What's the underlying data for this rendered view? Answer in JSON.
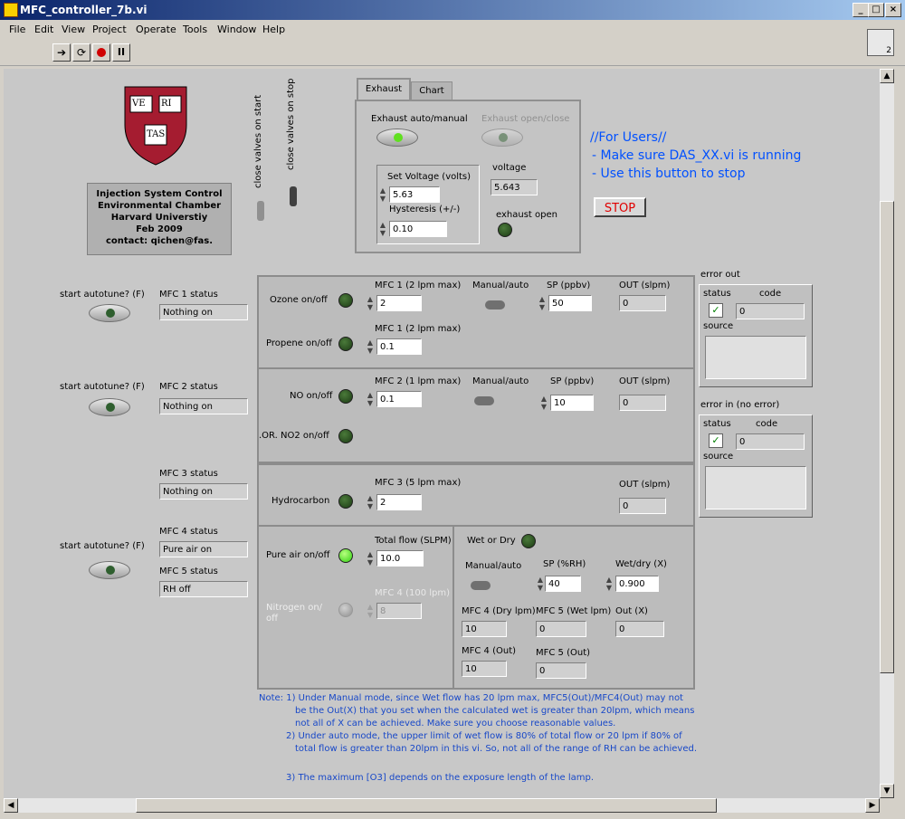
{
  "window": {
    "title": "MFC_controller_7b.vi",
    "min": "_",
    "max": "□",
    "close": "×"
  },
  "menu": [
    "File",
    "Edit",
    "View",
    "Project",
    "Operate",
    "Tools",
    "Window",
    "Help"
  ],
  "toolbar": {
    "icons": [
      "run-arrow-icon",
      "run-continuous-icon",
      "abort-icon",
      "pause-icon"
    ]
  },
  "context": {
    "num": "2"
  },
  "logo": {
    "v1": "VE",
    "v2": "RI",
    "v3": "TAS"
  },
  "info": {
    "lines": [
      "Injection System Control",
      "Environmental Chamber",
      "Harvard Universtiy",
      "Feb 2009",
      "contact: qichen@fas."
    ]
  },
  "valves": {
    "start": "close valves on start",
    "stop": "close valves on stop"
  },
  "tabs": {
    "exhaust": "Exhaust",
    "chart": "Chart"
  },
  "exhaust": {
    "auto_label": "Exhaust auto/manual",
    "open_label": "Exhaust open/close",
    "set_voltage_label": "Set Voltage (volts)",
    "set_voltage": "5.63",
    "voltage_label": "voltage",
    "voltage": "5.643",
    "hyst_label": "Hysteresis (+/-)",
    "hyst": "0.10",
    "open_led_label": "exhaust open"
  },
  "users": {
    "l1": "//For Users//",
    "l2": "- Make sure DAS_XX.vi is running",
    "l3": "- Use this button to stop",
    "stop": "STOP"
  },
  "autotune": {
    "label": "start autotune? (F)"
  },
  "mfc1": {
    "status_label": "MFC 1 status",
    "status": "Nothing on",
    "ozone": "Ozone on/off",
    "mfc_label": "MFC 1 (2 lpm max)",
    "val": "2",
    "propene": "Propene on/off",
    "mfc_label2": "MFC 1 (2 lpm max)",
    "val2": "0.1",
    "mode": "Manual/auto",
    "sp_label": "SP (ppbv)",
    "sp": "50",
    "out_label": "OUT (slpm)",
    "out": "0"
  },
  "mfc2": {
    "status_label": "MFC 2 status",
    "status": "Nothing on",
    "no": "NO on/off",
    "mfc_label": "MFC 2 (1 lpm max)",
    "val": "0.1",
    "no2": ".OR. NO2 on/off",
    "mode": "Manual/auto",
    "sp_label": "SP (ppbv)",
    "sp": "10",
    "out_label": "OUT (slpm)",
    "out": "0"
  },
  "mfc3": {
    "status_label": "MFC 3 status",
    "status": "Nothing on",
    "hc": "Hydrocarbon",
    "mfc_label": "MFC 3 (5 lpm max)",
    "val": "2",
    "out_label": "OUT (slpm)",
    "out": "0"
  },
  "mfc4": {
    "status_label": "MFC 4 status",
    "status": "Pure air on",
    "pure": "Pure air on/off",
    "total_label": "Total flow (SLPM)",
    "total": "10.0",
    "n2": "Nitrogen on/",
    "n2b": "off",
    "mfc4_label": "MFC 4 (100 lpm)",
    "mfc4_val": "8"
  },
  "mfc5": {
    "status_label": "MFC 5 status",
    "status": "RH off"
  },
  "wet": {
    "label": "Wet or Dry",
    "mode": "Manual/auto",
    "sp_label": "SP (%RH)",
    "sp": "40",
    "wd_label": "Wet/dry (X)",
    "wd": "0.900",
    "dry_label": "MFC 4 (Dry lpm)",
    "dry": "10",
    "wetl_label": "MFC 5 (Wet lpm)",
    "wetl": "0",
    "outx_label": "Out (X)",
    "outx": "0",
    "out4_label": "MFC 4 (Out)",
    "out4": "10",
    "out5_label": "MFC 5 (Out)",
    "out5": "0"
  },
  "errout": {
    "title": "error out",
    "status": "status",
    "code": "code",
    "codeval": "0",
    "source": "source",
    "check": "✓"
  },
  "errin": {
    "title": "error in (no error)",
    "status": "status",
    "code": "code",
    "codeval": "0",
    "source": "source",
    "check": "✓"
  },
  "notes": [
    "Note:  1) Under Manual mode, since Wet flow has 20 lpm max, MFC5(Out)/MFC4(Out) may not",
    "be the Out(X) that you set when the  calculated wet is greater than 20lpm, which means",
    "not all of X can be achieved. Make sure you choose reasonable values.",
    "2) Under auto mode, the upper limit of wet flow is 80% of total flow or 20 lpm if 80% of",
    "total flow is greater than 20lpm in this vi. So, not all of the range of RH can be achieved.",
    "3) The maximum [O3] depends on the exposure length of the lamp."
  ]
}
